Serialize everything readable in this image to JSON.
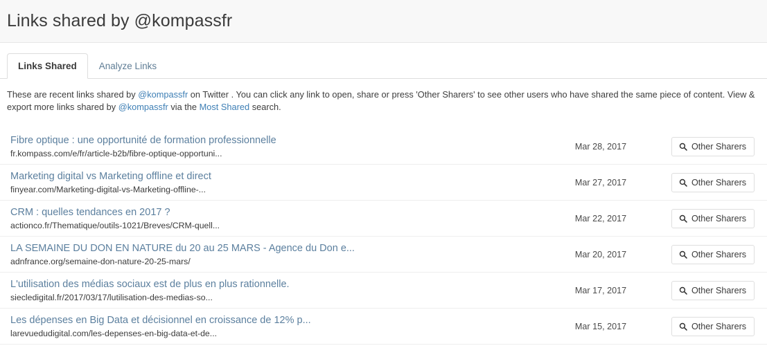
{
  "header": {
    "title": "Links shared by @kompassfr"
  },
  "tabs": [
    {
      "label": "Links Shared",
      "active": true
    },
    {
      "label": "Analyze Links",
      "active": false
    }
  ],
  "description": {
    "part1": "These are recent links shared by ",
    "handle1": "@kompassfr",
    "part2": " on Twitter . You can click any link to open, share or press 'Other Sharers' to see other users who have shared the same piece of content. View & export more links shared by ",
    "handle2": "@kompassfr",
    "part3": " via the ",
    "most_shared": "Most Shared",
    "part4": " search."
  },
  "button": {
    "label": "Other Sharers",
    "icon": "search-icon"
  },
  "links": [
    {
      "title": "Fibre optique : une opportunité de formation professionnelle",
      "url": "fr.kompass.com/e/fr/article-b2b/fibre-optique-opportuni...",
      "date": "Mar 28, 2017"
    },
    {
      "title": "Marketing digital vs Marketing offline et direct",
      "url": "finyear.com/Marketing-digital-vs-Marketing-offline-...",
      "date": "Mar 27, 2017"
    },
    {
      "title": "CRM : quelles tendances en 2017 ?",
      "url": "actionco.fr/Thematique/outils-1021/Breves/CRM-quell...",
      "date": "Mar 22, 2017"
    },
    {
      "title": "LA SEMAINE DU DON EN NATURE du 20 au 25 MARS - Agence du Don e...",
      "url": "adnfrance.org/semaine-don-nature-20-25-mars/",
      "date": "Mar 20, 2017"
    },
    {
      "title": "L'utilisation des médias sociaux est de plus en plus rationnelle.",
      "url": "siecledigital.fr/2017/03/17/lutilisation-des-medias-so...",
      "date": "Mar 17, 2017"
    },
    {
      "title": "Les dépenses en Big Data et décisionnel en croissance de 12% p...",
      "url": "larevuedudigital.com/les-depenses-en-big-data-et-de...",
      "date": "Mar 15, 2017"
    }
  ],
  "colors": {
    "header_bg": "#f8f8f8",
    "link_blue": "#5b7f9e",
    "anchor_blue": "#3e7fb5",
    "row_border": "#eeeeee"
  }
}
